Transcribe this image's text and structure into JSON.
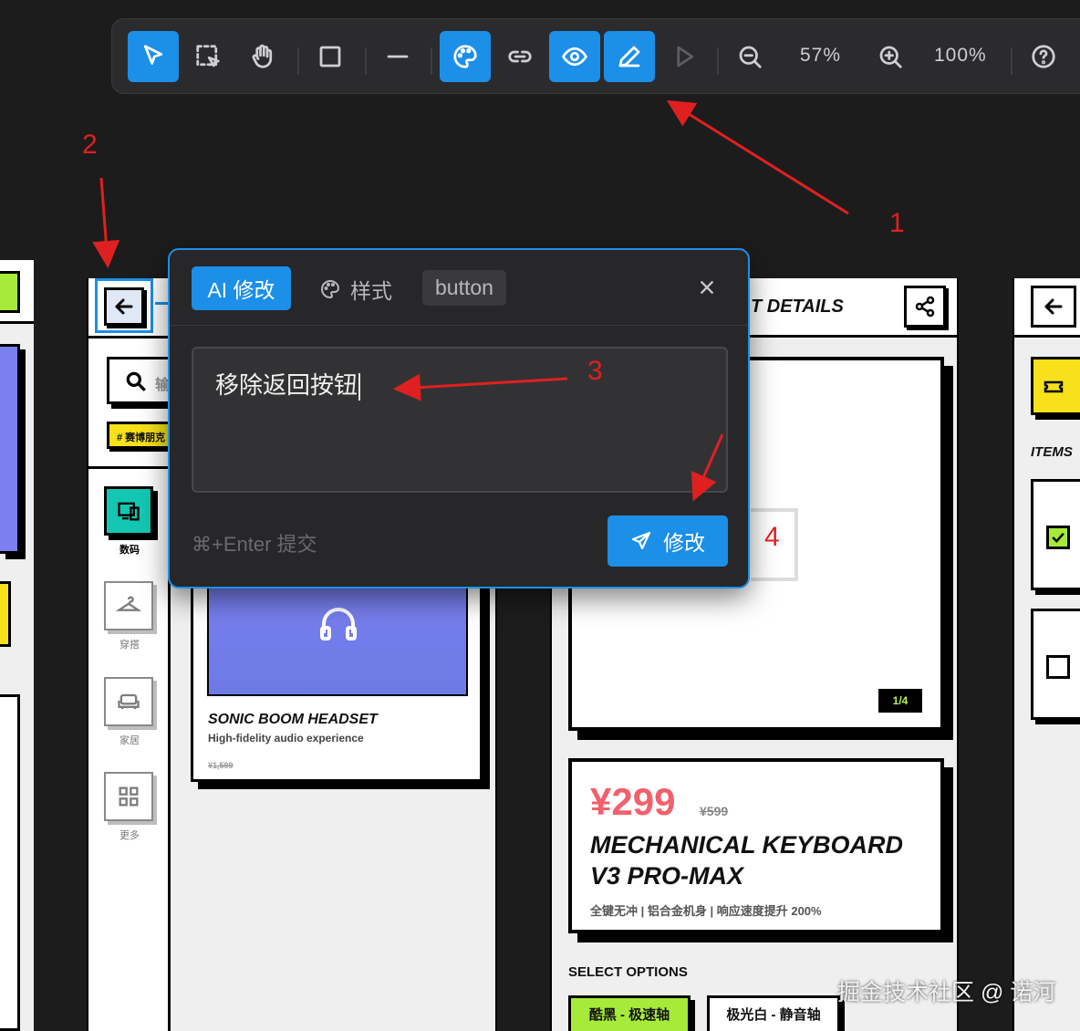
{
  "toolbar": {
    "zoom_level": "57%",
    "reset_zoom_label": "100%",
    "accent_color": "#1c8fe8"
  },
  "popup": {
    "tab_ai": "AI 修改",
    "tab_style": "样式",
    "element_tag": "button",
    "prompt_value": "移除返回按钮",
    "hint": "⌘+Enter 提交",
    "submit_label": "修改"
  },
  "annotations": {
    "n1": "1",
    "n2": "2",
    "n3": "3",
    "n4": "4"
  },
  "canvas": {
    "detail_header_fragment": "T DETAILS",
    "search_placeholder_fragment": "输",
    "tag_fragment": "# 赛博朋克",
    "categories": [
      {
        "label": "数码"
      },
      {
        "label": "穿搭"
      },
      {
        "label": "家居"
      },
      {
        "label": "更多"
      }
    ],
    "product_card": {
      "title": "SONIC BOOM HEADSET",
      "subtitle": "High-fidelity audio experience",
      "old_price": "¥1,599"
    },
    "gallery_counter": "1/4",
    "detail": {
      "price": "¥299",
      "old_price": "¥599",
      "title_line1": "MECHANICAL KEYBOARD",
      "title_line2": "V3 PRO-MAX",
      "features": "全键无冲 | 铝合金机身 | 响应速度提升 200%",
      "select_options_label": "SELECT OPTIONS",
      "options": [
        "酷黑 - 极速轴",
        "极光白 - 静音轴"
      ]
    },
    "cart_items_label": "ITEMS"
  },
  "watermark": "掘金技术社区 @ 诺河"
}
